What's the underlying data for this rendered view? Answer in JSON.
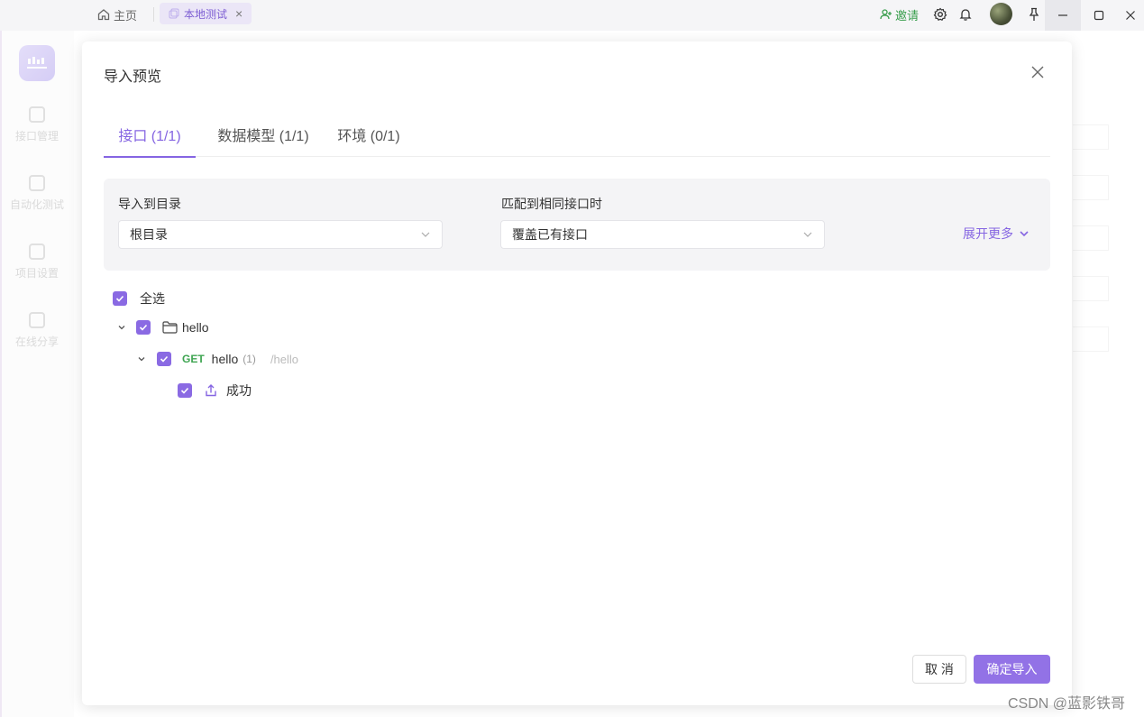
{
  "titlebar": {
    "home_label": "主页",
    "active_tab_label": "本地测试",
    "invite_label": "邀请"
  },
  "sidebar": {
    "items": [
      {
        "label": "接口管理"
      },
      {
        "label": "自动化测试"
      },
      {
        "label": "项目设置"
      },
      {
        "label": "在线分享"
      }
    ]
  },
  "modal": {
    "title": "导入预览",
    "tabs": [
      {
        "label": "接口 (1/1)"
      },
      {
        "label": "数据模型 (1/1)"
      },
      {
        "label": "环境 (0/1)"
      }
    ],
    "options": {
      "dir_label": "导入到目录",
      "dir_value": "根目录",
      "match_label": "匹配到相同接口时",
      "match_value": "覆盖已有接口",
      "expand_label": "展开更多"
    },
    "tree": {
      "select_all": "全选",
      "folder": "hello",
      "api": {
        "method": "GET",
        "name": "hello",
        "count": "(1)",
        "path": "/hello"
      },
      "response": "成功"
    },
    "buttons": {
      "cancel": "取 消",
      "ok": "确定导入"
    }
  },
  "watermark": "CSDN @蓝影铁哥",
  "colors": {
    "accent": "#8565e2",
    "get_method": "#3fa552",
    "invite": "#3a9e4e"
  }
}
